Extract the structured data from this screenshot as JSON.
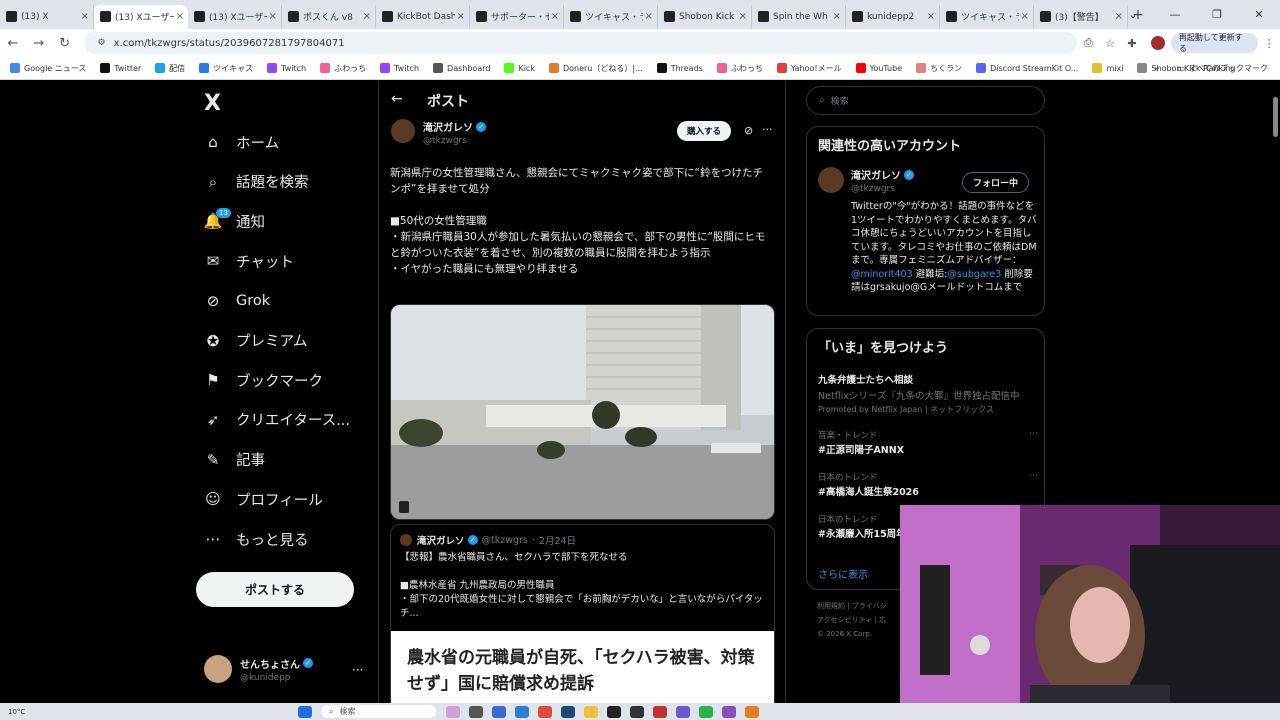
{
  "browser": {
    "tabs": [
      {
        "title": "(13) X",
        "icon": "x-icon",
        "active": false
      },
      {
        "title": "(13) Xユーザー",
        "icon": "x-icon",
        "active": true
      },
      {
        "title": "(13) Xユーザー",
        "icon": "x-icon",
        "active": false
      },
      {
        "title": "ポスくん v8",
        "icon": "globe-icon",
        "active": false
      },
      {
        "title": "KickBot Dash",
        "icon": "kick-icon",
        "active": false
      },
      {
        "title": "サポーター・セ",
        "icon": "loading-icon",
        "active": false
      },
      {
        "title": "ツイキャス・ラ",
        "icon": "twitcasting-icon",
        "active": false
      },
      {
        "title": "Shobon Kick",
        "icon": "shobon-icon",
        "active": false
      },
      {
        "title": "Spin the Wh",
        "icon": "google-icon",
        "active": false
      },
      {
        "title": "kunidepp2",
        "icon": "globe-icon",
        "active": false
      },
      {
        "title": "ツイキャス・ラ",
        "icon": "twitcasting-icon",
        "active": false
      },
      {
        "title": "(3)【警告】",
        "icon": "youtube-icon",
        "active": false
      }
    ],
    "url": "x.com/tkzwgrs/status/2039607281797804071",
    "relaunch_label": "再起動して更新する",
    "bookmarks": [
      "Google ニュース",
      "Twitter",
      "配信",
      "ツイキャス",
      "Twitch",
      "ふわっち",
      "Twitch",
      "Dashboard",
      "Kick",
      "Doneru（どねる）|...",
      "Threads",
      "ふわっち",
      "Yahoo!メール",
      "YouTube",
      "ちくラン",
      "Discord StreamKit O...",
      "mixi",
      "Shobon Kick Ranking"
    ],
    "all_bookmarks": "すべてのブックマーク"
  },
  "sidebar": {
    "logo": "X",
    "items": [
      {
        "label": "ホーム",
        "icon": "home-icon"
      },
      {
        "label": "話題を検索",
        "icon": "search-icon"
      },
      {
        "label": "通知",
        "icon": "bell-icon",
        "badge": "13"
      },
      {
        "label": "チャット",
        "icon": "chat-icon"
      },
      {
        "label": "Grok",
        "icon": "grok-icon"
      },
      {
        "label": "プレミアム",
        "icon": "premium-icon"
      },
      {
        "label": "ブックマーク",
        "icon": "bookmark-icon"
      },
      {
        "label": "クリエイタース...",
        "icon": "rocket-icon"
      },
      {
        "label": "記事",
        "icon": "article-icon"
      },
      {
        "label": "プロフィール",
        "icon": "profile-icon"
      },
      {
        "label": "もっと見る",
        "icon": "more-icon"
      }
    ],
    "post_button": "ポストする",
    "account": {
      "name": "せんちょさん",
      "handle": "@kunidepp"
    }
  },
  "post": {
    "header": "ポスト",
    "author_name": "滝沢ガレソ",
    "author_handle": "@tkzwgrs",
    "buy_label": "購入する",
    "text": "新潟県庁の女性管理職さん、懇親会にてミャクミャク姿で部下に“鈴をつけたチンポ”を拝ませて処分\n\n■50代の女性管理職\n・新潟県庁職員30人が参加した暑気払いの懇親会で、部下の男性に“股間にヒモと鈴がついた衣装”を着させ、別の複数の職員に股間を拝むよう指示\n・イヤがった職員にも無理やり拝ませる",
    "quote": {
      "author_name": "滝沢ガレソ",
      "author_handle": "@tkzwgrs",
      "date": "2月24日",
      "text": "【悲報】農水省職員さん、セクハラで部下を死なせる\n\n■農林水産省 九州農政局の男性職員\n・部下の20代既婚女性に対して懇親会で「お前胸がデカいな」と言いながらパイタッチ...",
      "image_headline": "農水省の元職員が自死、「セクハラ被害、対策せず」国に賠償求め提訴"
    }
  },
  "right": {
    "search_placeholder": "検索",
    "related": {
      "title": "関連性の高いアカウント",
      "name": "滝沢ガレソ",
      "handle": "@tkzwgrs",
      "follow_label": "フォロー中",
      "bio_a": "Twitterの\"今\"がわかる！話題の事件などを1ツイートでわかりやすくまとめます。タバコ休憩にちょうどいいアカウントを目指しています。タレコミやお仕事のご依頼はDMまで。専属フェミニズムアドバイザー：",
      "bio_link1": "@minorit403",
      "bio_b": " 避難垢:",
      "bio_link2": "@subgare3",
      "bio_c": " 削除要請はgrsakujo@Gメールドットコムまで"
    },
    "trends": {
      "title": "「いま」を見つけよう",
      "items": [
        {
          "category": "",
          "title": "九条弁護士たちへ相談",
          "subtitle": "Netflixシリーズ『九条の大罪』世界独占配信中",
          "promo": "Promoted by Netflix Japan | ネットフリックス"
        },
        {
          "category": "音楽・トレンド",
          "title": "#正源司陽子ANNX",
          "subtitle": "",
          "promo": ""
        },
        {
          "category": "日本のトレンド",
          "title": "#高橋海人誕生祭2026",
          "subtitle": "",
          "promo": ""
        },
        {
          "category": "日本のトレンド",
          "title": "#永瀬廉入所15周年",
          "subtitle": "",
          "promo": ""
        }
      ],
      "show_more": "さらに表示"
    },
    "footer": [
      "利用規約 | プライバシ",
      "アクセシビリティ | 広",
      "© 2026 X Corp."
    ]
  },
  "taskbar": {
    "weather": "10°C",
    "search": "検索"
  },
  "colors": {
    "accent": "#1d9bf0",
    "background": "#000000",
    "text": "#e7e9ea",
    "muted": "#71767b"
  }
}
